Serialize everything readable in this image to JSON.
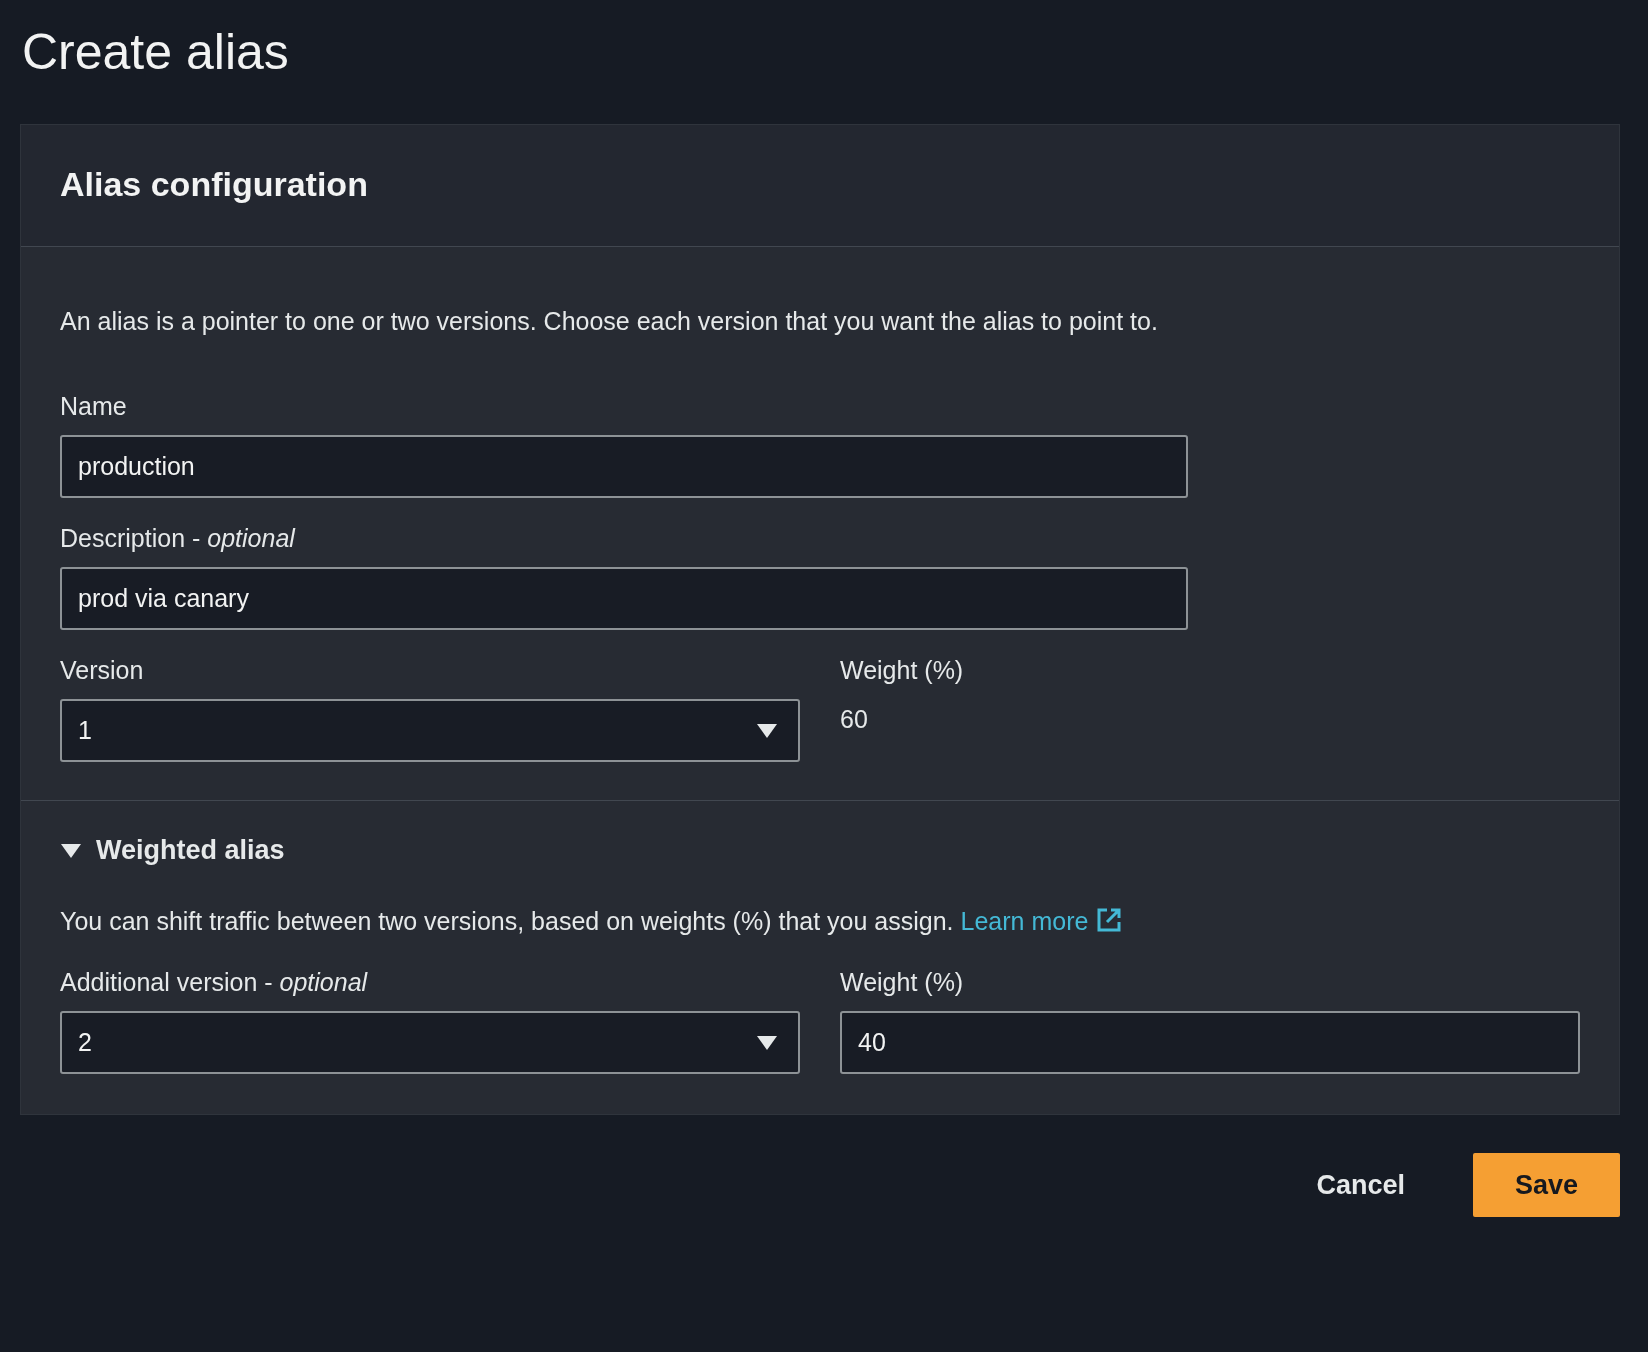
{
  "page_title": "Create alias",
  "panel": {
    "heading": "Alias configuration",
    "intro": "An alias is a pointer to one or two versions. Choose each version that you want the alias to point to.",
    "name": {
      "label": "Name",
      "value": "production"
    },
    "description": {
      "label": "Description - *optional*",
      "value": "prod via canary"
    },
    "version": {
      "label": "Version",
      "value": "1"
    },
    "weight": {
      "label": "Weight (%)",
      "value": "60"
    }
  },
  "weighted_alias": {
    "title": "Weighted alias",
    "expanded": true,
    "text": "You can shift traffic between two versions, based on weights (%) that you assign.",
    "link": "Learn more",
    "additional_version": {
      "label": "Additional version - *optional*",
      "value": "2"
    },
    "weight": {
      "label": "Weight (%)",
      "value": "40"
    }
  },
  "buttons": [
    {
      "label": "Cancel",
      "kind": "link"
    },
    {
      "label": "Save",
      "kind": "primary"
    }
  ]
}
